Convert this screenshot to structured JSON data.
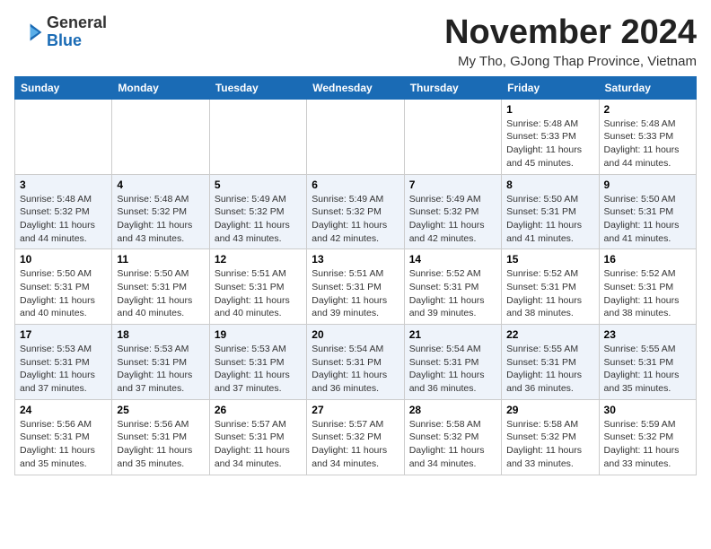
{
  "header": {
    "logo_general": "General",
    "logo_blue": "Blue",
    "month_title": "November 2024",
    "subtitle": "My Tho, GJong Thap Province, Vietnam"
  },
  "weekdays": [
    "Sunday",
    "Monday",
    "Tuesday",
    "Wednesday",
    "Thursday",
    "Friday",
    "Saturday"
  ],
  "weeks": [
    [
      {
        "day": "",
        "info": ""
      },
      {
        "day": "",
        "info": ""
      },
      {
        "day": "",
        "info": ""
      },
      {
        "day": "",
        "info": ""
      },
      {
        "day": "",
        "info": ""
      },
      {
        "day": "1",
        "info": "Sunrise: 5:48 AM\nSunset: 5:33 PM\nDaylight: 11 hours\nand 45 minutes."
      },
      {
        "day": "2",
        "info": "Sunrise: 5:48 AM\nSunset: 5:33 PM\nDaylight: 11 hours\nand 44 minutes."
      }
    ],
    [
      {
        "day": "3",
        "info": "Sunrise: 5:48 AM\nSunset: 5:32 PM\nDaylight: 11 hours\nand 44 minutes."
      },
      {
        "day": "4",
        "info": "Sunrise: 5:48 AM\nSunset: 5:32 PM\nDaylight: 11 hours\nand 43 minutes."
      },
      {
        "day": "5",
        "info": "Sunrise: 5:49 AM\nSunset: 5:32 PM\nDaylight: 11 hours\nand 43 minutes."
      },
      {
        "day": "6",
        "info": "Sunrise: 5:49 AM\nSunset: 5:32 PM\nDaylight: 11 hours\nand 42 minutes."
      },
      {
        "day": "7",
        "info": "Sunrise: 5:49 AM\nSunset: 5:32 PM\nDaylight: 11 hours\nand 42 minutes."
      },
      {
        "day": "8",
        "info": "Sunrise: 5:50 AM\nSunset: 5:31 PM\nDaylight: 11 hours\nand 41 minutes."
      },
      {
        "day": "9",
        "info": "Sunrise: 5:50 AM\nSunset: 5:31 PM\nDaylight: 11 hours\nand 41 minutes."
      }
    ],
    [
      {
        "day": "10",
        "info": "Sunrise: 5:50 AM\nSunset: 5:31 PM\nDaylight: 11 hours\nand 40 minutes."
      },
      {
        "day": "11",
        "info": "Sunrise: 5:50 AM\nSunset: 5:31 PM\nDaylight: 11 hours\nand 40 minutes."
      },
      {
        "day": "12",
        "info": "Sunrise: 5:51 AM\nSunset: 5:31 PM\nDaylight: 11 hours\nand 40 minutes."
      },
      {
        "day": "13",
        "info": "Sunrise: 5:51 AM\nSunset: 5:31 PM\nDaylight: 11 hours\nand 39 minutes."
      },
      {
        "day": "14",
        "info": "Sunrise: 5:52 AM\nSunset: 5:31 PM\nDaylight: 11 hours\nand 39 minutes."
      },
      {
        "day": "15",
        "info": "Sunrise: 5:52 AM\nSunset: 5:31 PM\nDaylight: 11 hours\nand 38 minutes."
      },
      {
        "day": "16",
        "info": "Sunrise: 5:52 AM\nSunset: 5:31 PM\nDaylight: 11 hours\nand 38 minutes."
      }
    ],
    [
      {
        "day": "17",
        "info": "Sunrise: 5:53 AM\nSunset: 5:31 PM\nDaylight: 11 hours\nand 37 minutes."
      },
      {
        "day": "18",
        "info": "Sunrise: 5:53 AM\nSunset: 5:31 PM\nDaylight: 11 hours\nand 37 minutes."
      },
      {
        "day": "19",
        "info": "Sunrise: 5:53 AM\nSunset: 5:31 PM\nDaylight: 11 hours\nand 37 minutes."
      },
      {
        "day": "20",
        "info": "Sunrise: 5:54 AM\nSunset: 5:31 PM\nDaylight: 11 hours\nand 36 minutes."
      },
      {
        "day": "21",
        "info": "Sunrise: 5:54 AM\nSunset: 5:31 PM\nDaylight: 11 hours\nand 36 minutes."
      },
      {
        "day": "22",
        "info": "Sunrise: 5:55 AM\nSunset: 5:31 PM\nDaylight: 11 hours\nand 36 minutes."
      },
      {
        "day": "23",
        "info": "Sunrise: 5:55 AM\nSunset: 5:31 PM\nDaylight: 11 hours\nand 35 minutes."
      }
    ],
    [
      {
        "day": "24",
        "info": "Sunrise: 5:56 AM\nSunset: 5:31 PM\nDaylight: 11 hours\nand 35 minutes."
      },
      {
        "day": "25",
        "info": "Sunrise: 5:56 AM\nSunset: 5:31 PM\nDaylight: 11 hours\nand 35 minutes."
      },
      {
        "day": "26",
        "info": "Sunrise: 5:57 AM\nSunset: 5:31 PM\nDaylight: 11 hours\nand 34 minutes."
      },
      {
        "day": "27",
        "info": "Sunrise: 5:57 AM\nSunset: 5:32 PM\nDaylight: 11 hours\nand 34 minutes."
      },
      {
        "day": "28",
        "info": "Sunrise: 5:58 AM\nSunset: 5:32 PM\nDaylight: 11 hours\nand 34 minutes."
      },
      {
        "day": "29",
        "info": "Sunrise: 5:58 AM\nSunset: 5:32 PM\nDaylight: 11 hours\nand 33 minutes."
      },
      {
        "day": "30",
        "info": "Sunrise: 5:59 AM\nSunset: 5:32 PM\nDaylight: 11 hours\nand 33 minutes."
      }
    ]
  ]
}
